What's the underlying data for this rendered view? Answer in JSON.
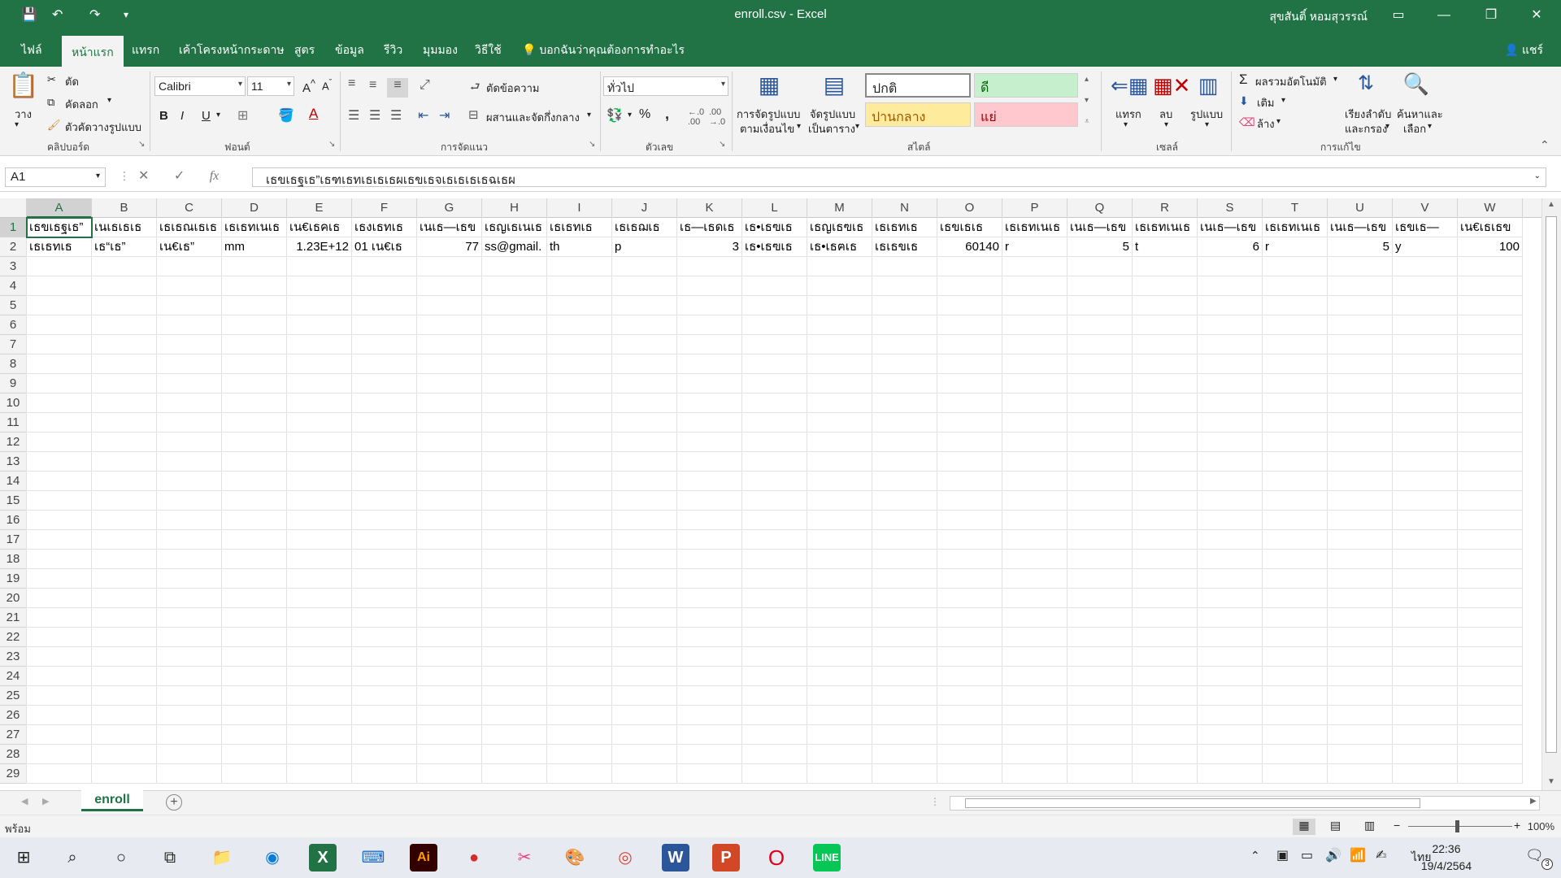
{
  "window": {
    "title": "enroll.csv  -  Excel",
    "user": "สุขสันติ์ หอมสุวรรณ์"
  },
  "ribbon_tabs": [
    "ไฟล์",
    "หน้าแรก",
    "แทรก",
    "เค้าโครงหน้ากระดาษ",
    "สูตร",
    "ข้อมูล",
    "รีวิว",
    "มุมมอง",
    "วิธีใช้"
  ],
  "active_tab": "หน้าแรก",
  "tell_me": "บอกฉันว่าคุณต้องการทำอะไร",
  "share": "แชร์",
  "clipboard": {
    "paste": "วาง",
    "cut": "ตัด",
    "copy": "คัดลอก",
    "format_painter": "ตัวคัดวางรูปแบบ",
    "label": "คลิปบอร์ด"
  },
  "font": {
    "name": "Calibri",
    "size": "11",
    "label": "ฟอนต์",
    "bold": "B",
    "italic": "I",
    "underline": "U"
  },
  "alignment": {
    "wrap": "ตัดข้อความ",
    "merge": "ผสานและจัดกึ่งกลาง",
    "label": "การจัดแนว"
  },
  "number": {
    "format": "ทั่วไป",
    "label": "ตัวเลข",
    "percent": "%",
    "comma": ","
  },
  "styles": {
    "conditional": [
      "การจัดรูปแบบ",
      "ตามเงื่อนไข"
    ],
    "table": [
      "จัดรูปแบบ",
      "เป็นตาราง"
    ],
    "normal": "ปกติ",
    "good": "ดี",
    "neutral": "ปานกลาง",
    "bad": "แย่",
    "label": "สไตล์"
  },
  "cells": {
    "insert": "แทรก",
    "delete": "ลบ",
    "format": "รูปแบบ",
    "label": "เซลล์"
  },
  "editing": {
    "autosum": "ผลรวมอัตโนมัติ",
    "fill": "เติม",
    "clear": "ล้าง",
    "sort": [
      "เรียงลำดับ",
      "และกรอง"
    ],
    "find": [
      "ค้นหาและ",
      "เลือก"
    ],
    "label": "การแก้ไข"
  },
  "name_box": "A1",
  "formula": "เธขเธฐเธ”เธฑเธทเธเธเธผเธขเธจเธเธเธเธฉเธผ",
  "columns": [
    "A",
    "B",
    "C",
    "D",
    "E",
    "F",
    "G",
    "H",
    "I",
    "J",
    "K",
    "L",
    "M",
    "N",
    "O",
    "P",
    "Q",
    "R",
    "S",
    "T",
    "U",
    "V",
    "W"
  ],
  "rows": [
    "1",
    "2",
    "3",
    "4",
    "5",
    "6",
    "7",
    "8",
    "9",
    "10",
    "11",
    "12",
    "13",
    "14",
    "15",
    "16",
    "17",
    "18",
    "19",
    "20",
    "21",
    "22",
    "23",
    "24",
    "25",
    "26",
    "27",
    "28",
    "29"
  ],
  "row1": [
    "เธขเธฐเธ”",
    "เนเธเธเธ",
    "เธเธณเธเธ",
    "เธเธทเนเธ",
    "เน€เธคเธ",
    "เธงเธทเธ",
    "เนเธ—เธข",
    "เธญเธเนเธ",
    "เธเธทเธ",
    "เธเธฌเธ",
    "เธ—เธดเธ",
    "เธ•เธฃเธ",
    "เธญเธฃเธ",
    "เธเธทเธ",
    "เธขเธเธ",
    "เธเธทเนเธ",
    "เนเธ—เธข",
    "เธเธทเนเธ",
    "เนเธ—เธข",
    "เธเธทเนเธ",
    "เนเธ—เธข",
    "เธขเธ—",
    "เน€เธเธข"
  ],
  "row2": [
    "เธเธทเธ",
    "เธ“เธ”",
    "เน€เธ”",
    "mm",
    "1.23E+12",
    "01 เน€เธ",
    "77",
    "ss@gmail.",
    "th",
    "p",
    "3",
    "เธ•เธฃเธ",
    "เธ•เธฅเธ",
    "เธเธขเธ",
    "60140",
    "r",
    "5",
    "t",
    "6",
    "r",
    "5",
    "y",
    "100"
  ],
  "sheet_tab": "enroll",
  "status": "พร้อม",
  "zoom": "100%",
  "clock": {
    "time": "22:36",
    "date": "19/4/2564",
    "lang": "ไทย"
  },
  "notification_count": "3"
}
